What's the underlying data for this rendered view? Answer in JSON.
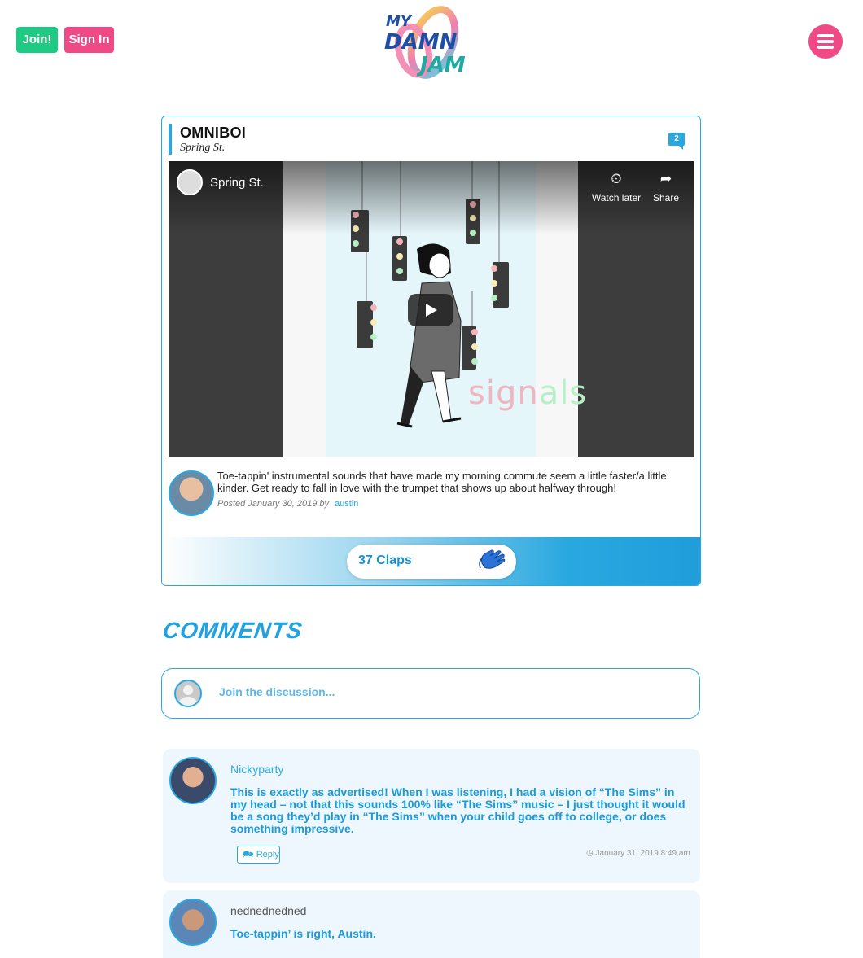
{
  "header": {
    "join_label": "Join!",
    "signin_label": "Sign In",
    "logo_text": "MY DAMN JAM",
    "accent_green": "#1fcb84",
    "accent_pink": "#ef4a86"
  },
  "post": {
    "title": "OMNIBOI",
    "subtitle": "Spring St.",
    "comment_count": "2",
    "video": {
      "title": "Spring St.",
      "watch_later": "Watch later",
      "share": "Share",
      "overlay_word_1": "sign",
      "overlay_word_2": "als"
    },
    "body": "Toe-tappin' instrumental sounds that have made my morning commute seem a little faster/a little kinder. Get ready to fall in love with the trumpet that shows up about halfway through!",
    "posted_prefix": "Posted January 30, 2019 by",
    "author": "austin",
    "claps_label": "37 Claps",
    "accent_blue": "#29a8e0"
  },
  "comments": {
    "heading": "COMMENTS",
    "input_placeholder": "Join the discussion...",
    "items": [
      {
        "user": "Nickyparty",
        "text": "This is exactly as advertised! When I was listening, I had a vision of “The Sims” in my head – not that this sounds 100% like “The Sims” music – I just thought it would be a song they’d play in “The Sims” when your child goes off to college, or does something impressive.",
        "reply_label": "Reply",
        "date": "January 31, 2019 8:49 am"
      },
      {
        "user": "nednednedned",
        "text": "Toe-tappin’ is right, Austin."
      }
    ]
  }
}
